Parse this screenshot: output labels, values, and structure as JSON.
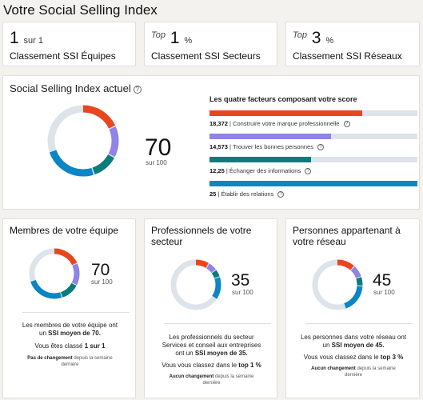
{
  "page_title": "Votre Social Selling Index",
  "rankings": [
    {
      "prefix": "",
      "value": "1",
      "suffix": "sur 1",
      "label": "Classement SSI Équipes"
    },
    {
      "prefix": "Top",
      "value": "1",
      "suffix": "%",
      "label": "Classement SSI Secteurs"
    },
    {
      "prefix": "Top",
      "value": "3",
      "suffix": "%",
      "label": "Classement SSI Réseaux"
    }
  ],
  "ssi": {
    "title": "Social Selling Index actuel",
    "score": "70",
    "out_of": "sur 100",
    "factors_title": "Les quatre facteurs composant votre score",
    "factors": [
      {
        "value": "18,372",
        "label": "Construire votre marque professionnelle",
        "level": 0.735,
        "color": "#e8461e"
      },
      {
        "value": "14,573",
        "label": "Trouver les bonnes personnes",
        "level": 0.583,
        "color": "#8f83e6"
      },
      {
        "value": "12,25",
        "label": "Échanger des informations",
        "level": 0.49,
        "color": "#0a7c7c"
      },
      {
        "value": "25",
        "label": "Établir des relations",
        "level": 1.0,
        "color": "#0b86c4"
      }
    ]
  },
  "cards": [
    {
      "title": "Membres de votre équipe",
      "score": "70",
      "out_of": "sur 100",
      "desc_1": "Les membres de votre équipe ont",
      "desc_2_pre": "un ",
      "desc_2_bold": "SSI moyen de 70.",
      "rank_pre": "Vous êtes classé ",
      "rank_bold": "1 sur 1",
      "note_bold": "Pas de changement",
      "note_rest": "depuis la semaine",
      "note_2": "dernière"
    },
    {
      "title": "Professionnels de votre secteur",
      "score": "35",
      "out_of": "sur 100",
      "desc_1": "Les professionnels du secteur",
      "desc_2": "Services et conseil aux entreprises",
      "desc_3_pre": "ont un ",
      "desc_3_bold": "SSI moyen de 35.",
      "rank_pre": "Vous vous classez dans le ",
      "rank_bold": "top 1 %",
      "note_bold": "Aucun changement",
      "note_rest": "depuis la semaine",
      "note_2": "dernière"
    },
    {
      "title": "Personnes appartenant à votre réseau",
      "score": "45",
      "out_of": "sur 100",
      "desc_1": "Les personnes dans votre réseau ont",
      "desc_2_pre": "un ",
      "desc_2_bold": "SSI moyen de 45.",
      "rank_pre": "Vous vous classez dans le ",
      "rank_bold": "top 3 %",
      "note_bold": "Aucun changement",
      "note_rest": "depuis la semaine",
      "note_2": "dernière"
    }
  ],
  "donut_segments": {
    "ssi": [
      0.184,
      0.146,
      0.122,
      0.25
    ],
    "team": [
      0.184,
      0.146,
      0.122,
      0.25
    ],
    "sector": [
      0.09,
      0.06,
      0.05,
      0.15
    ],
    "network": [
      0.12,
      0.08,
      0.06,
      0.19
    ]
  },
  "colors": {
    "orange": "#e8461e",
    "purple": "#8f83e6",
    "teal": "#0a7c7c",
    "blue": "#0b86c4",
    "track": "#dce4ea"
  }
}
